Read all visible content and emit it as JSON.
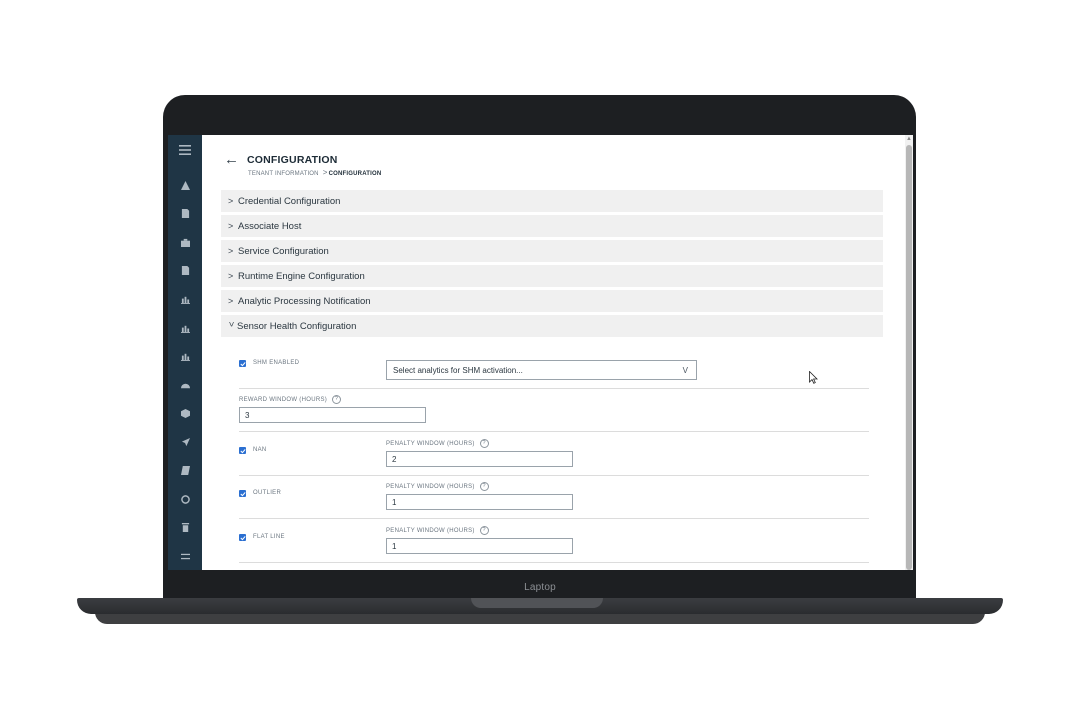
{
  "device": {
    "brand_label": "Laptop"
  },
  "sidebar": {
    "items": [
      {
        "icon": "menu-icon"
      },
      {
        "icon": "warning-icon"
      },
      {
        "icon": "document-icon"
      },
      {
        "icon": "briefcase-icon"
      },
      {
        "icon": "document-icon"
      },
      {
        "icon": "bar-chart-icon"
      },
      {
        "icon": "bar-chart-icon"
      },
      {
        "icon": "bar-chart-icon"
      },
      {
        "icon": "dashboard-icon"
      },
      {
        "icon": "cube-icon"
      },
      {
        "icon": "rocket-icon"
      },
      {
        "icon": "book-icon"
      },
      {
        "icon": "refresh-icon"
      },
      {
        "icon": "trash-icon"
      },
      {
        "icon": "swap-icon"
      }
    ]
  },
  "header": {
    "back_arrow": "←",
    "title": "CONFIGURATION",
    "breadcrumb": {
      "parent": "TENANT INFORMATION",
      "separator": ">",
      "current": "CONFIGURATION"
    }
  },
  "sections": [
    {
      "label": "Credential Configuration",
      "expanded": false
    },
    {
      "label": "Associate Host",
      "expanded": false
    },
    {
      "label": "Service Configuration",
      "expanded": false
    },
    {
      "label": "Runtime Engine Configuration",
      "expanded": false
    },
    {
      "label": "Analytic Processing Notification",
      "expanded": false
    },
    {
      "label": "Sensor Health Configuration",
      "expanded": true
    }
  ],
  "sensor_health": {
    "shm_enabled": {
      "label": "SHM ENABLED",
      "checked": true
    },
    "analytics_select": {
      "placeholder": "Select analytics for SHM activation...",
      "caret": "V"
    },
    "reward_window": {
      "label": "REWARD WINDOW (HOURS)",
      "value": "3"
    },
    "checks": [
      {
        "label": "NAN",
        "checked": true,
        "penalty_label": "PENALTY WINDOW (HOURS)",
        "value": "2"
      },
      {
        "label": "OUTLIER",
        "checked": true,
        "penalty_label": "PENALTY WINDOW (HOURS)",
        "value": "1"
      },
      {
        "label": "FLAT LINE",
        "checked": true,
        "penalty_label": "PENALTY WINDOW (HOURS)",
        "value": "1"
      }
    ],
    "help_glyph": "?"
  },
  "colors": {
    "sidebar": "#1f3545",
    "accent": "#2b6fd1",
    "accordion": "#f0f0f0"
  }
}
